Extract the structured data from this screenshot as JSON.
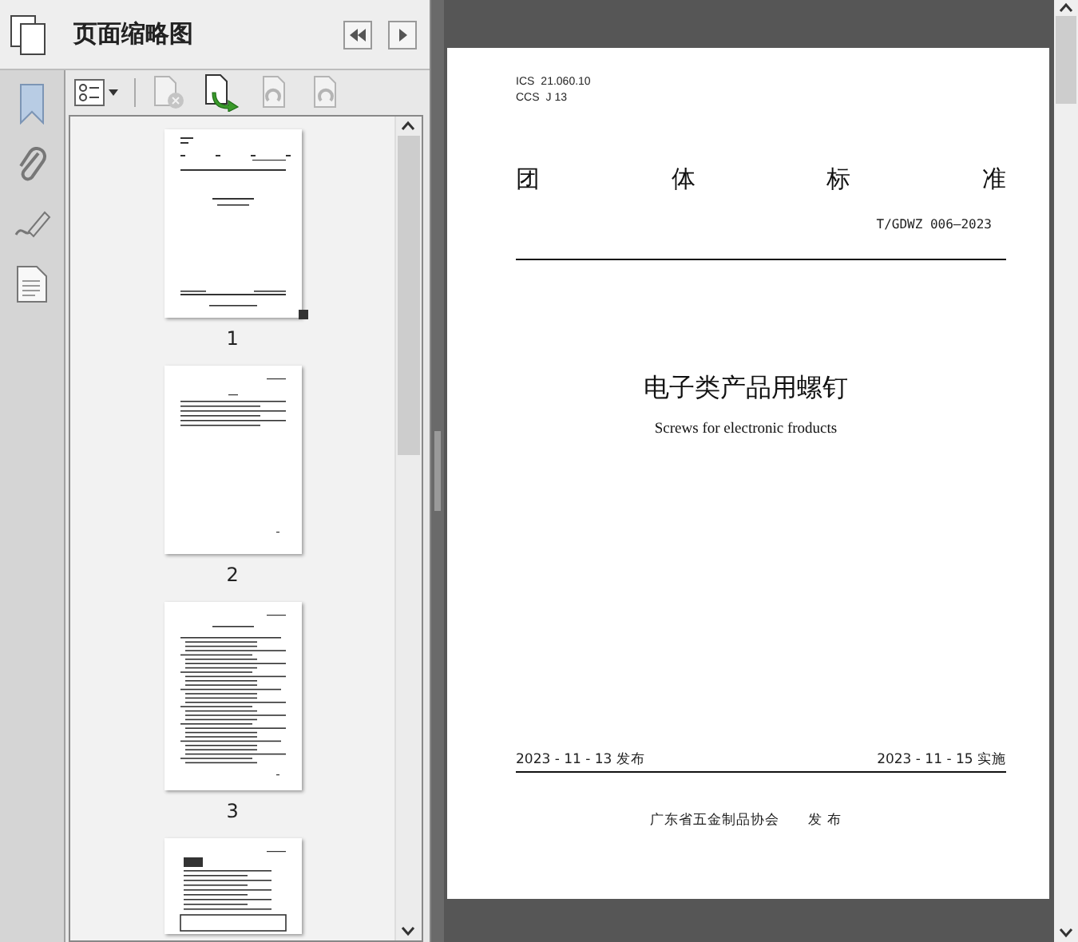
{
  "panel": {
    "title": "页面缩略图"
  },
  "thumbnails": [
    {
      "label": "1",
      "kind": "cover",
      "selected": true
    },
    {
      "label": "2",
      "kind": "sparse",
      "selected": false
    },
    {
      "label": "3",
      "kind": "dense",
      "selected": false
    },
    {
      "kind": "table",
      "selected": false
    }
  ],
  "document": {
    "ics_label": "ICS",
    "ics_code": "21.060.10",
    "ccs_label": "CCS",
    "ccs_code": "J 13",
    "standard_type": [
      "团",
      "体",
      "标",
      "准"
    ],
    "number": "T/GDWZ 006—2023",
    "title": "电子类产品用螺钉",
    "subtitle": "Screws for electronic froducts",
    "issued": "2023 - 11 - 13 发布",
    "effective": "2023 - 11 - 15 实施",
    "publisher": "广东省五金制品协会",
    "publish_word": "发 布"
  }
}
